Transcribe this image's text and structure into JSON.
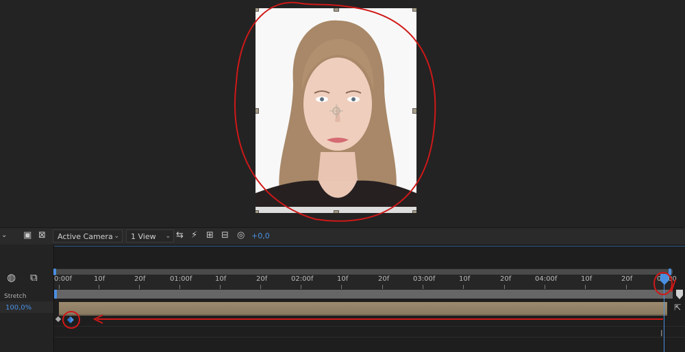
{
  "toolbar": {
    "camera_dropdown": "Active Camera",
    "view_dropdown": "1 View",
    "exposure_value": "+0,0"
  },
  "timeline": {
    "ruler_labels": [
      "0:00f",
      "10f",
      "20f",
      "01:00f",
      "10f",
      "20f",
      "02:00f",
      "10f",
      "20f",
      "03:00f",
      "10f",
      "20f",
      "04:00f",
      "10f",
      "20f",
      "05:00"
    ],
    "stretch_label": "Stretch",
    "stretch_value": "100,0%"
  },
  "colors": {
    "accent_blue": "#4a90e2",
    "annotation_red": "#d01818",
    "layer_bar": "#9c8a6e"
  },
  "icons": [
    "motion-blur-icon",
    "comp-flowchart-icon",
    "region-icon",
    "transparency-grid-icon",
    "reset-exposure-icon",
    "fast-previews-icon",
    "toggle-transparency-icon",
    "flowchart-icon",
    "exposure-icon"
  ]
}
